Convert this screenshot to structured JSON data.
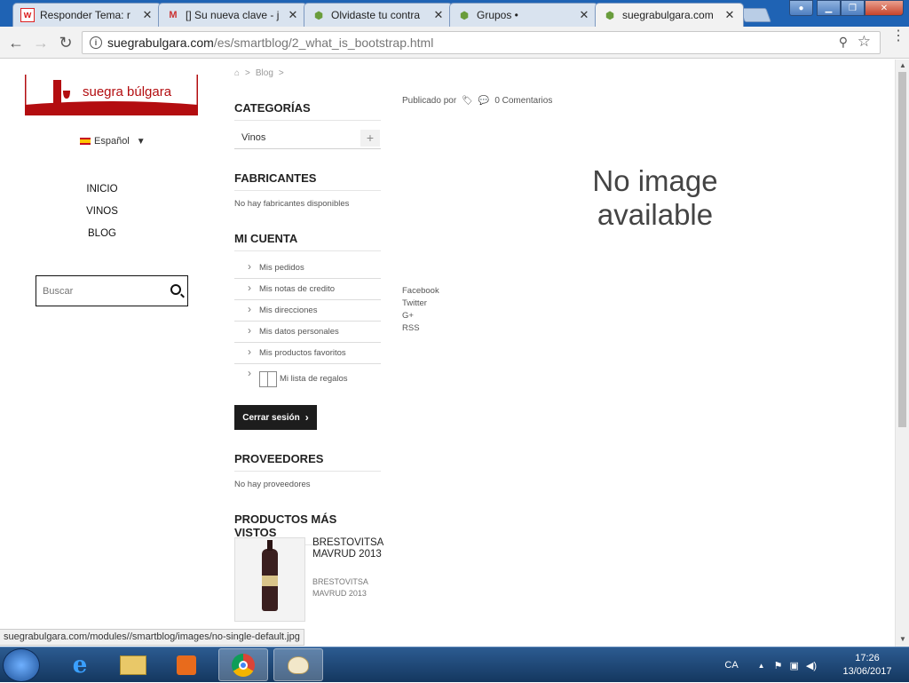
{
  "browser": {
    "tabs": [
      {
        "title": "Responder Tema: r",
        "icon": "w",
        "color": "#d22"
      },
      {
        "title": "[] Su nueva clave - j",
        "icon": "M",
        "color": "#c33"
      },
      {
        "title": "Olvidaste tu contra",
        "icon": "⬢",
        "color": "#6a9d3c"
      },
      {
        "title": "Grupos •",
        "icon": "⬢",
        "color": "#6a9d3c"
      },
      {
        "title": "suegrabulgara.com",
        "icon": "⬢",
        "color": "#6a9d3c"
      }
    ],
    "url_host": "suegrabulgara.com",
    "url_path": "/es/smartblog/2_what_is_bootstrap.html",
    "info_icon": "i"
  },
  "site": {
    "logo_text": "suegra búlgara",
    "language": "Español",
    "nav": [
      "INICIO",
      "VINOS",
      "BLOG"
    ],
    "search_placeholder": "Buscar"
  },
  "breadcrumb": {
    "home_icon": "⌂",
    "sep": ">",
    "blog": "Blog",
    "sep2": ">"
  },
  "sidebar": {
    "categories_title": "CATEGORÍAS",
    "category": "Vinos",
    "category_toggle": "+",
    "manufacturers_title": "FABRICANTES",
    "manufacturers_empty": "No hay fabricantes disponibles",
    "account_title": "MI CUENTA",
    "account_items": [
      "Mis pedidos",
      "Mis notas de credito",
      "Mis direcciones",
      "Mis datos personales",
      "Mis productos favoritos"
    ],
    "gift_list": "Mi lista de regalos",
    "logout": "Cerrar sesión",
    "suppliers_title": "PROVEEDORES",
    "suppliers_empty": "No hay proveedores",
    "viewed_title": "PRODUCTOS MÁS VISTOS",
    "product_name": "BRESTOVITSA MAVRUD 2013",
    "product_sub": "BRESTOVITSA MAVRUD 2013"
  },
  "post": {
    "published_by": "Publicado por",
    "comments": "0 Comentarios",
    "no_image_line1": "No image",
    "no_image_line2": "available",
    "share": [
      "Facebook",
      "Twitter",
      "G+",
      "RSS"
    ]
  },
  "status_url": "suegrabulgara.com/modules//smartblog/images/no-single-default.jpg",
  "taskbar": {
    "lang": "CA",
    "time": "17:26",
    "date": "13/06/2017"
  }
}
